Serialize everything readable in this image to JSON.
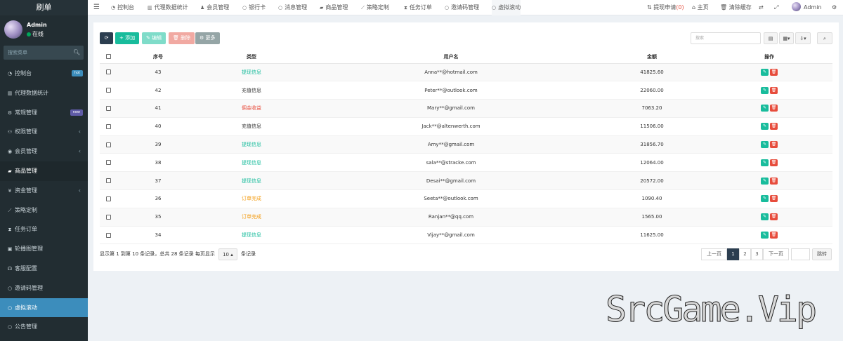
{
  "brand": {
    "title": "刷单"
  },
  "user": {
    "name": "Admin",
    "status": "在线"
  },
  "sidebar": {
    "search_placeholder": "搜索菜单",
    "items": [
      {
        "label": "控制台",
        "icon": "dashboard-icon",
        "badge": "hot"
      },
      {
        "label": "代理数据统计",
        "icon": "bar-chart-icon"
      },
      {
        "label": "常规管理",
        "icon": "cogs-icon",
        "badge": "new"
      },
      {
        "label": "权限管理",
        "icon": "group-icon",
        "caret": "‹"
      },
      {
        "label": "会员管理",
        "icon": "user-circle-icon",
        "caret": "‹"
      },
      {
        "label": "商品管理",
        "icon": "shopping-bag-icon"
      },
      {
        "label": "资金管理",
        "icon": "yen-icon",
        "caret": "‹"
      },
      {
        "label": "策略定制",
        "icon": "line-chart-icon"
      },
      {
        "label": "任务订单",
        "icon": "hourglass-icon"
      },
      {
        "label": "轮播图管理",
        "icon": "image-file-icon"
      },
      {
        "label": "客服配置",
        "icon": "headset-icon"
      },
      {
        "label": "邀请码管理",
        "icon": "circle-icon"
      },
      {
        "label": "虚拟滚动",
        "icon": "circle-icon"
      },
      {
        "label": "公告管理",
        "icon": "circle-icon"
      }
    ]
  },
  "topnav": {
    "tabs": [
      {
        "label": "控制台",
        "icon": "dashboard-icon"
      },
      {
        "label": "代理数据统计",
        "icon": "bar-chart-icon"
      },
      {
        "label": "会员管理",
        "icon": "user-icon"
      },
      {
        "label": "银行卡",
        "icon": "circle-icon"
      },
      {
        "label": "消息管理",
        "icon": "circle-icon"
      },
      {
        "label": "商品管理",
        "icon": "shopping-bag-icon"
      },
      {
        "label": "策略定制",
        "icon": "line-chart-icon"
      },
      {
        "label": "任务订单",
        "icon": "hourglass-icon"
      },
      {
        "label": "邀请码管理",
        "icon": "circle-icon"
      },
      {
        "label": "虚拟滚动",
        "icon": "circle-icon"
      }
    ],
    "withdraw_label": "提现申请",
    "withdraw_count": "(0)",
    "home": "主页",
    "clear_cache": "清除缓存",
    "admin": "Admin"
  },
  "toolbar": {
    "add": "添加",
    "edit": "编辑",
    "delete": "删除",
    "more": "更多",
    "search_placeholder": "搜索"
  },
  "table": {
    "headers": [
      "序号",
      "类型",
      "用户名",
      "金额",
      "操作"
    ],
    "rows": [
      {
        "id": "43",
        "type": "提现信息",
        "type_color": "green",
        "user": "Anna**@hotmail.com",
        "amount": "41825.60"
      },
      {
        "id": "42",
        "type": "充值信息",
        "type_color": "default",
        "user": "Peter**@outlook.com",
        "amount": "22060.00"
      },
      {
        "id": "41",
        "type": "佣金收益",
        "type_color": "red",
        "user": "Mary**@gmail.com",
        "amount": "7063.20"
      },
      {
        "id": "40",
        "type": "充值信息",
        "type_color": "default",
        "user": "Jack**@altenwerth.com",
        "amount": "11506.00"
      },
      {
        "id": "39",
        "type": "提现信息",
        "type_color": "green",
        "user": "Amy**@gmail.com",
        "amount": "31856.70"
      },
      {
        "id": "38",
        "type": "提现信息",
        "type_color": "green",
        "user": "sala**@stracke.com",
        "amount": "12064.00"
      },
      {
        "id": "37",
        "type": "提现信息",
        "type_color": "green",
        "user": "Desai**@gmail.com",
        "amount": "20572.00"
      },
      {
        "id": "36",
        "type": "订单完成",
        "type_color": "orange",
        "user": "Seeta**@outlook.com",
        "amount": "1090.40"
      },
      {
        "id": "35",
        "type": "订单完成",
        "type_color": "orange",
        "user": "Ranjan**@qq.com",
        "amount": "1565.00"
      },
      {
        "id": "34",
        "type": "提现信息",
        "type_color": "green",
        "user": "Vijay**@gmail.com",
        "amount": "11625.00"
      }
    ]
  },
  "footer": {
    "info_prefix": "显示第 1 到第 10 条记录，总共 28 条记录 每页显示",
    "page_size": "10",
    "info_suffix": "条记录",
    "prev": "上一页",
    "pages": [
      "1",
      "2",
      "3"
    ],
    "next": "下一页",
    "jump": "跳转"
  },
  "colors": {
    "sidebar_bg": "#222d32",
    "active": "#3c8dbc",
    "success": "#18bc9c",
    "danger": "#e74c3c",
    "warning": "#f39c12"
  },
  "watermark": "SrcGame.Vip"
}
